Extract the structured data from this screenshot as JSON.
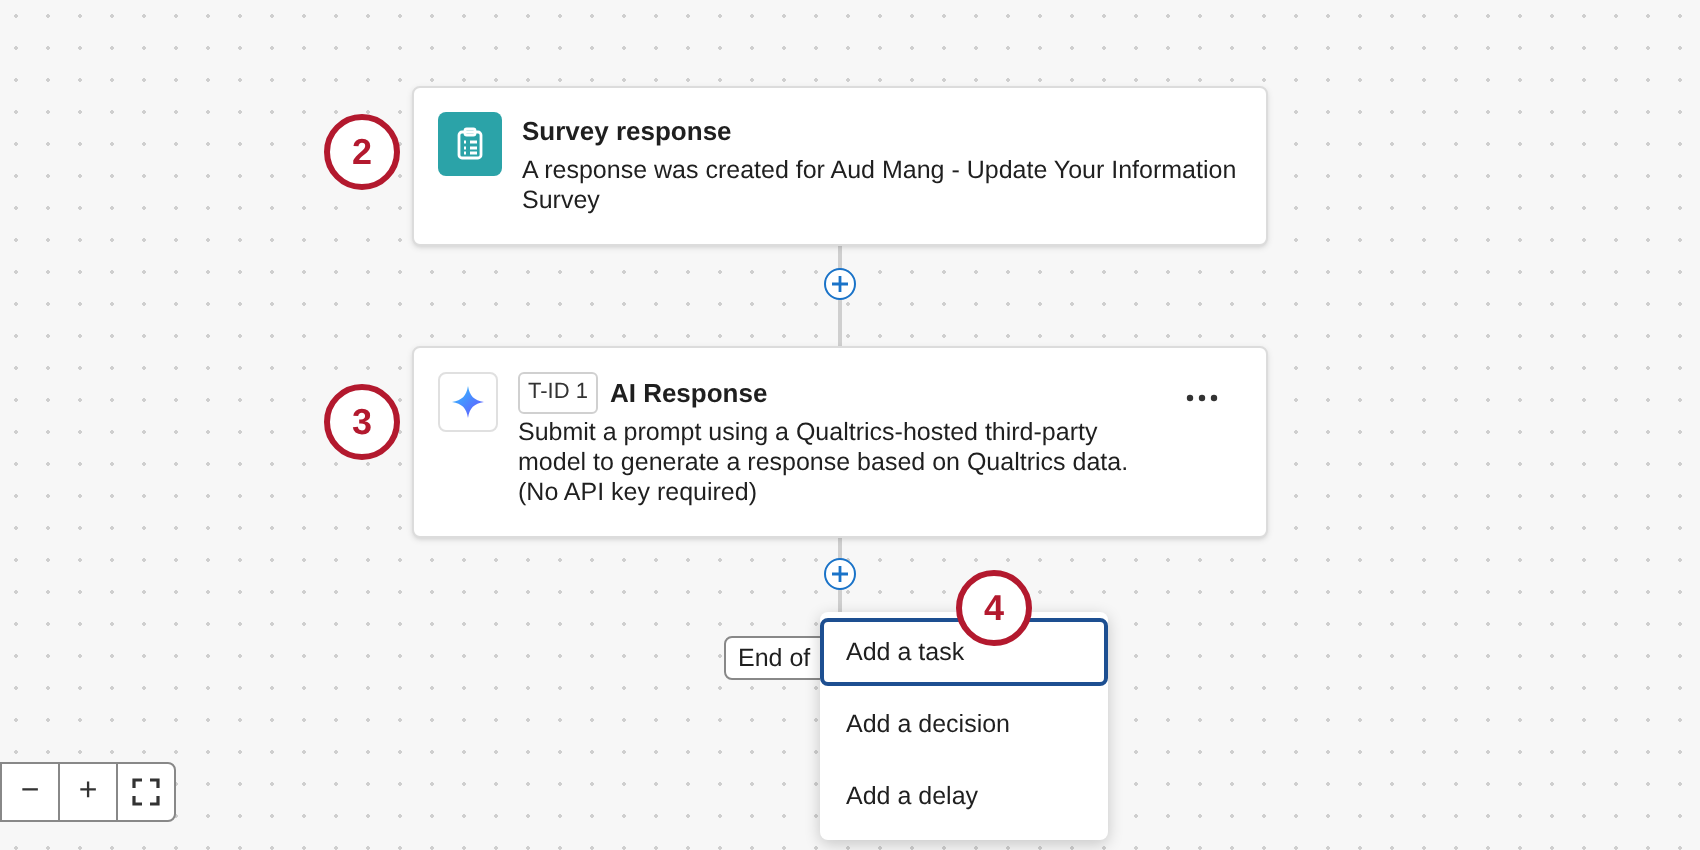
{
  "nodes": [
    {
      "kind": "trigger",
      "title": "Survey response",
      "description": "A response was created for Aud Mang - Update Your Information Survey",
      "callout": "2"
    },
    {
      "kind": "task",
      "tag": "T-ID 1",
      "title": "AI Response",
      "description": "Submit a prompt using a Qualtrics-hosted third-party model to generate a response based on Qualtrics data. (No API key required)",
      "callout": "3"
    }
  ],
  "end_button": "End of",
  "add_menu": {
    "callout": "4",
    "items": [
      {
        "label": "Add a task",
        "selected": true
      },
      {
        "label": "Add a decision",
        "selected": false
      },
      {
        "label": "Add a delay",
        "selected": false
      }
    ]
  },
  "zoom_controls": [
    "−",
    "+"
  ]
}
